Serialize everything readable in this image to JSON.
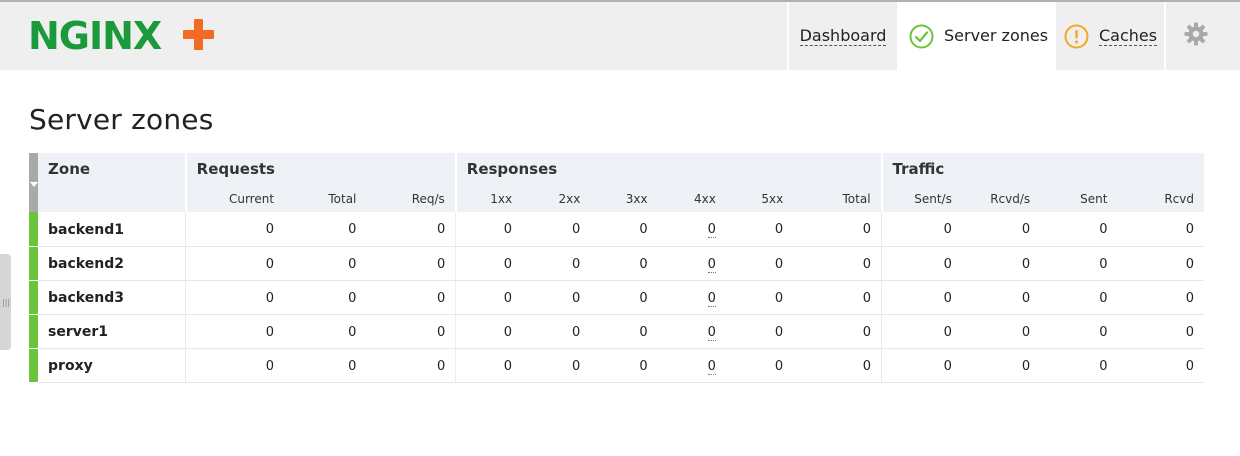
{
  "app": {
    "logo_text": "NGINX+"
  },
  "nav": {
    "tabs": [
      {
        "label": "Dashboard"
      },
      {
        "label": "Server zones",
        "status": "ok"
      },
      {
        "label": "Caches",
        "status": "warning"
      }
    ]
  },
  "page": {
    "title": "Server zones"
  },
  "table": {
    "groups": {
      "zone": "Zone",
      "requests": "Requests",
      "responses": "Responses",
      "traffic": "Traffic"
    },
    "columns": [
      "Current",
      "Total",
      "Req/s",
      "1xx",
      "2xx",
      "3xx",
      "4xx",
      "5xx",
      "Total",
      "Sent/s",
      "Rcvd/s",
      "Sent",
      "Rcvd"
    ],
    "rows": [
      {
        "zone": "backend1",
        "values": [
          "0",
          "0",
          "0",
          "0",
          "0",
          "0",
          "0",
          "0",
          "0",
          "0",
          "0",
          "0",
          "0"
        ]
      },
      {
        "zone": "backend2",
        "values": [
          "0",
          "0",
          "0",
          "0",
          "0",
          "0",
          "0",
          "0",
          "0",
          "0",
          "0",
          "0",
          "0"
        ]
      },
      {
        "zone": "backend3",
        "values": [
          "0",
          "0",
          "0",
          "0",
          "0",
          "0",
          "0",
          "0",
          "0",
          "0",
          "0",
          "0",
          "0"
        ]
      },
      {
        "zone": "server1",
        "values": [
          "0",
          "0",
          "0",
          "0",
          "0",
          "0",
          "0",
          "0",
          "0",
          "0",
          "0",
          "0",
          "0"
        ]
      },
      {
        "zone": "proxy",
        "values": [
          "0",
          "0",
          "0",
          "0",
          "0",
          "0",
          "0",
          "0",
          "0",
          "0",
          "0",
          "0",
          "0"
        ]
      }
    ]
  },
  "colors": {
    "logo_green": "#1a9a3a",
    "logo_plus": "#f26b22",
    "status_ok": "#6cc33d",
    "status_warning": "#f5a623",
    "header_bg": "#efefef",
    "table_header_bg": "#eef2f6"
  },
  "icons": {
    "zones_tab": "check-circle-icon",
    "caches_tab": "alert-circle-icon",
    "settings": "gear-icon"
  }
}
